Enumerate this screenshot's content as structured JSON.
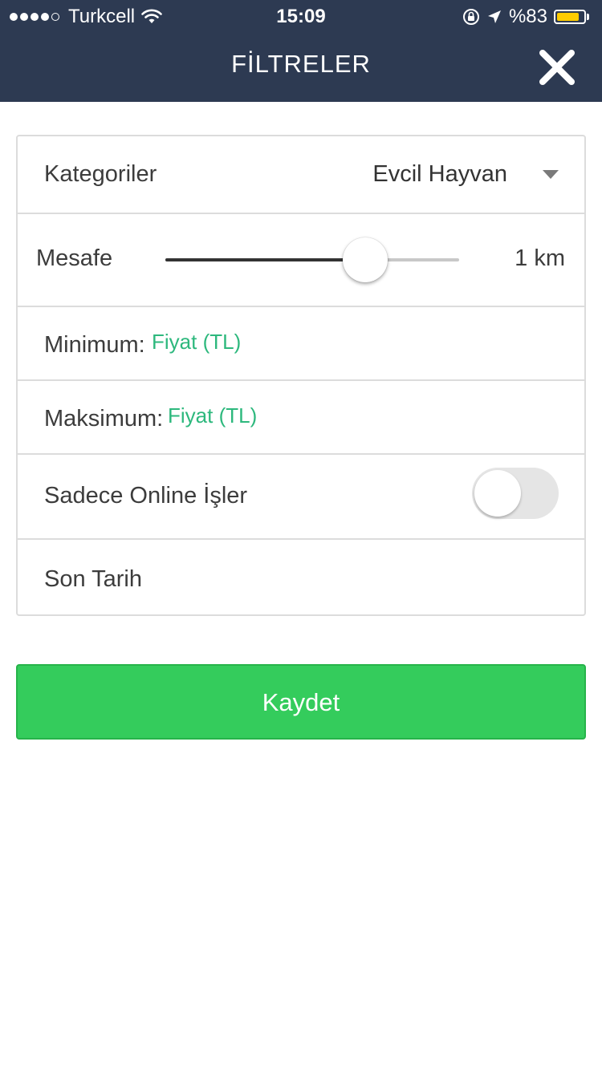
{
  "status_bar": {
    "carrier": "Turkcell",
    "time": "15:09",
    "battery_text": "%83",
    "battery_level": 0.83,
    "signal_bars": 4
  },
  "header": {
    "title": "FİLTRELER",
    "close_icon": "close-icon"
  },
  "filters": {
    "category": {
      "label": "Kategoriler",
      "value": "Evcil Hayvan"
    },
    "distance": {
      "label": "Mesafe",
      "value_text": "1 km",
      "slider_fraction": 0.68
    },
    "minimum": {
      "label": "Minimum:",
      "placeholder": "Fiyat (TL)"
    },
    "maximum": {
      "label": "Maksimum:",
      "placeholder": "Fiyat (TL)"
    },
    "online_only": {
      "label": "Sadece Online İşler",
      "enabled": false
    },
    "deadline": {
      "label": "Son Tarih"
    }
  },
  "save_button": {
    "label": "Kaydet"
  },
  "colors": {
    "header_bg": "#2d3a52",
    "accent_green": "#34cc5c",
    "placeholder_green": "#2db87d",
    "battery_yellow": "#ffcc00"
  }
}
